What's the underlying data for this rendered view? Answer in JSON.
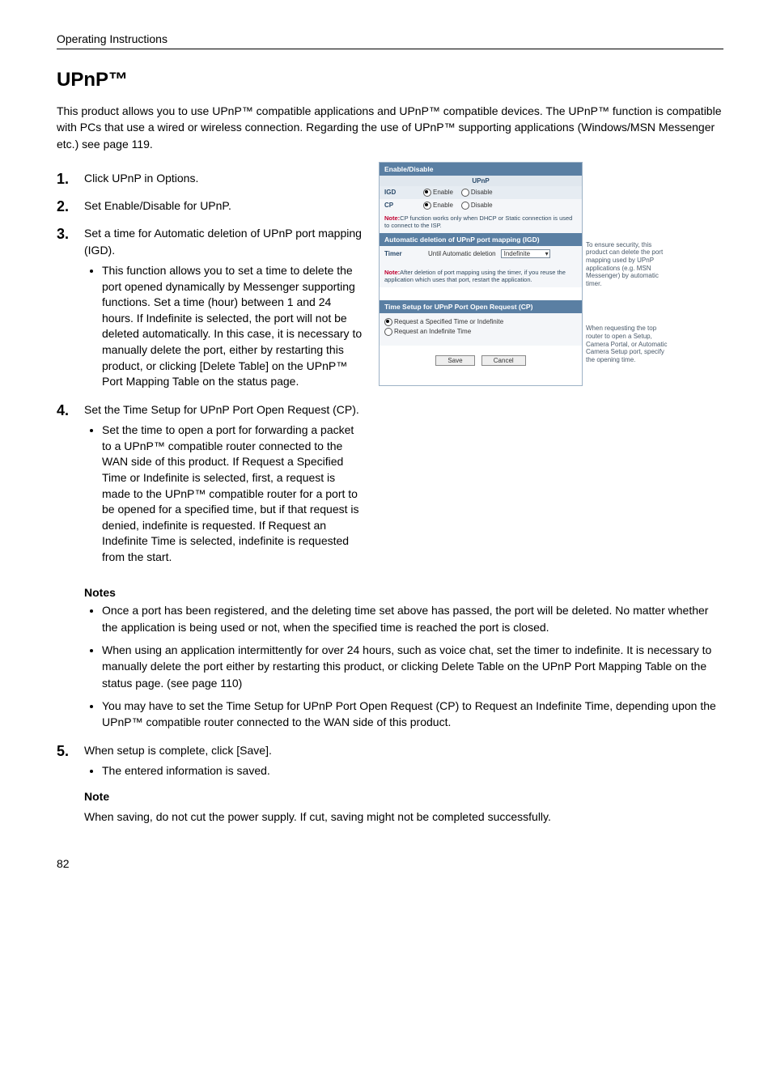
{
  "header": "Operating Instructions",
  "title": "UPnP™",
  "intro": "This product allows you to use UPnP™ compatible applications and UPnP™ compatible devices. The UPnP™ function is compatible with PCs that use a wired or wireless connection. Regarding the use of UPnP™ supporting applications (Windows/MSN Messenger etc.) see page 119.",
  "steps": {
    "s1": "Click UPnP in Options.",
    "s2": "Set Enable/Disable for UPnP.",
    "s3": "Set a time for Automatic deletion of UPnP port mapping (IGD).",
    "s3_bullet": "This function allows you to set a time to delete the port opened dynamically by Messenger supporting functions. Set a time (hour) between 1 and 24 hours. If Indefinite is selected, the port will not be deleted automatically. In this case, it is necessary to manually delete the port, either by restarting this product, or clicking [Delete Table] on the UPnP™ Port Mapping Table on the status page.",
    "s4": "Set the Time Setup for UPnP Port Open Request (CP).",
    "s4_bullet": "Set the time to open a port for forwarding a packet to a UPnP™ compatible router connected to the WAN side of this product. If Request a Specified Time or Indefinite is selected, first, a request is made to the UPnP™ compatible router for a port to be opened for a specified time, but if that request is denied, indefinite is requested. If Request an Indefinite Time is selected, indefinite is requested from the start.",
    "s5": "When setup is complete, click [Save].",
    "s5_bullet": "The entered information is saved."
  },
  "notes_label": "Notes",
  "notes": {
    "n1": "Once a port has been registered, and the deleting time set above has passed, the port will be deleted. No matter whether the application is being used or not, when the specified time is reached the port is closed.",
    "n2": "When using an application intermittently for over 24 hours, such as voice chat, set the timer to indefinite. It is necessary to manually delete the port either by restarting this product, or clicking Delete Table on the UPnP Port Mapping Table on the status page. (see page 110)",
    "n3": "You may have to set the Time Setup for UPnP Port Open Request (CP) to Request an Indefinite Time, depending upon the UPnP™ compatible router connected to the WAN side of this product."
  },
  "note2_label": "Note",
  "note2_text": "When saving, do not cut the power supply. If cut, saving might not be completed successfully.",
  "page_number": "82",
  "screenshot": {
    "sect_enable": "Enable/Disable",
    "subhead_upnp": "UPnP",
    "row_igd_label": "IGD",
    "row_cp_label": "CP",
    "opt_enable": "Enable",
    "opt_disable": "Disable",
    "note1_bold": "Note:",
    "note1_rest": "CP function works only when DHCP or Static connection is used to connect to the ISP.",
    "sect_auto": "Automatic deletion of UPnP port mapping (IGD)",
    "timer_label": "Timer",
    "timer_text": "Until Automatic deletion",
    "timer_select": "Indefinite",
    "note2_bold": "Note:",
    "note2_rest": "After deletion of port mapping using the timer, if you reuse the application which uses that port, restart the application.",
    "sect_time": "Time Setup for UPnP Port Open Request (CP)",
    "radio_spec": "Request a Specified Time or Indefinite",
    "radio_indef": "Request an Indefinite Time",
    "btn_save": "Save",
    "btn_cancel": "Cancel",
    "side1": "To ensure security, this product can delete the port mapping used by UPnP applications (e.g. MSN Messenger) by automatic timer.",
    "side2": "When requesting the top router to open a Setup, Camera Portal, or Automatic Camera Setup port, specify the opening time."
  }
}
